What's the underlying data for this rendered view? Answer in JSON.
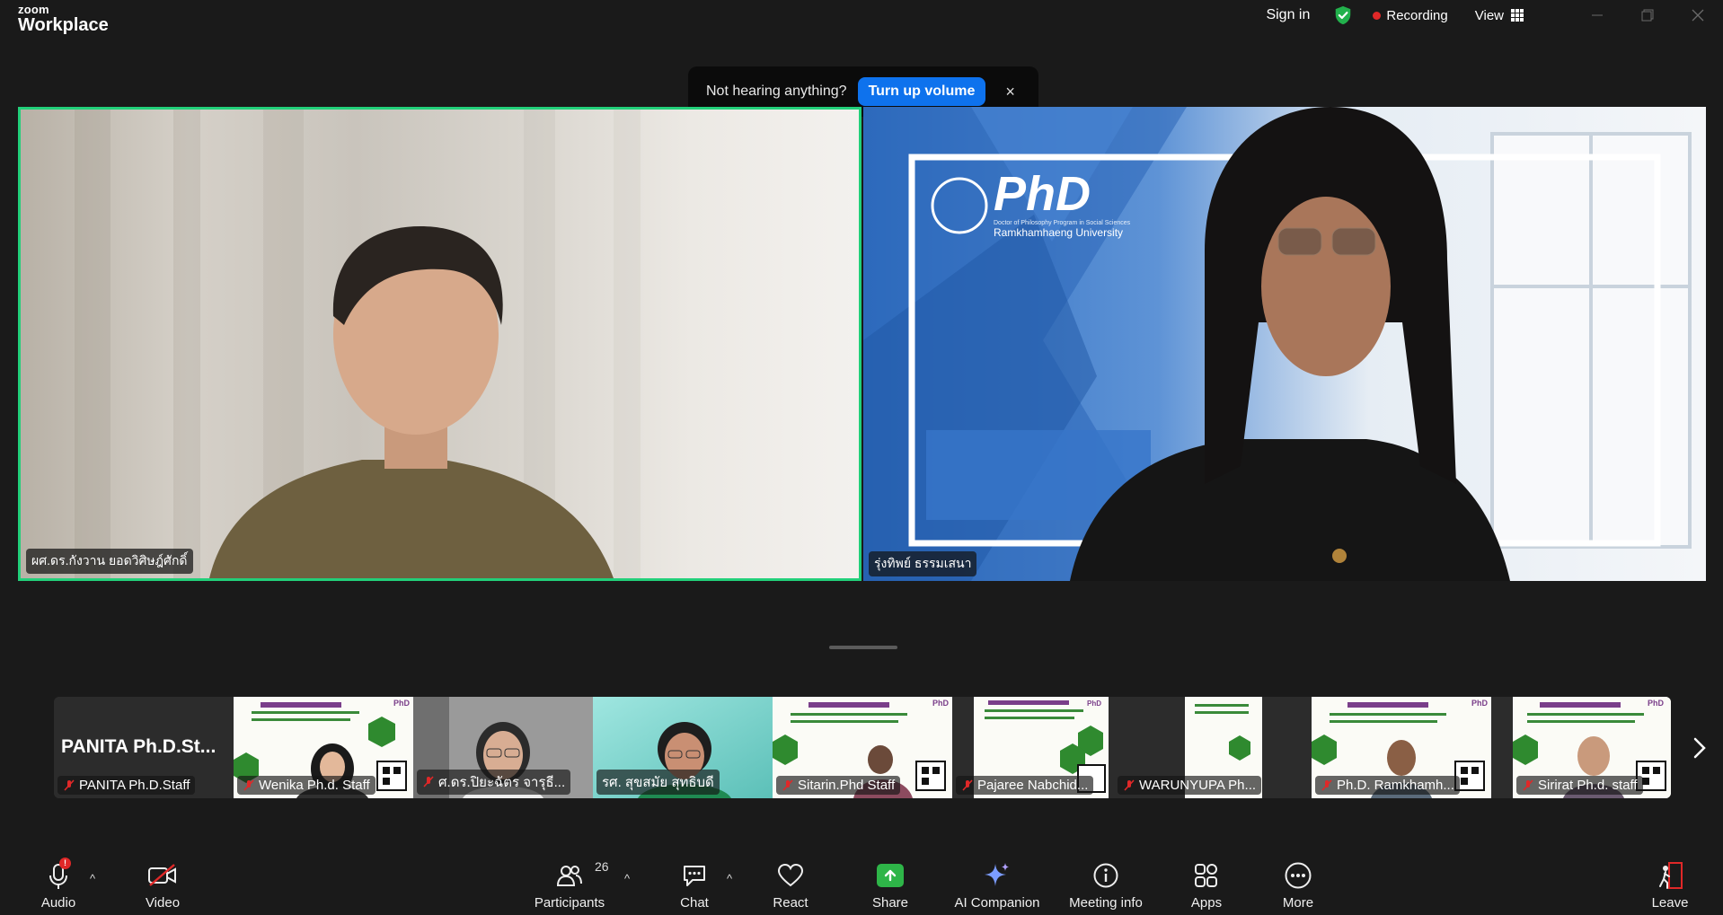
{
  "app": {
    "logo_line1": "zoom",
    "logo_line2": "Workplace"
  },
  "titlebar": {
    "sign_in": "Sign in",
    "recording": "Recording",
    "view": "View"
  },
  "toast": {
    "message": "Not hearing anything?",
    "button": "Turn up volume",
    "close": "×"
  },
  "main_videos": [
    {
      "name": "ผศ.ดร.กังวาน ยอดวิศิษฎ์ศักดิ์",
      "active_speaker": true
    },
    {
      "name": "รุ่งทิพย์ ธรรมเสนา",
      "active_speaker": false
    }
  ],
  "background_overlay": {
    "brand": "PhD",
    "line1": "Doctor of Philosophy Program in Social Sciences",
    "line2": "Ramkhamhaeng University"
  },
  "thumbnails": [
    {
      "name": "PANITA Ph.D.Staff",
      "display": "PANITA  Ph.D.St...",
      "muted": true,
      "video": false
    },
    {
      "name": "Wenika Ph.d. Staff",
      "muted": true,
      "video": true
    },
    {
      "name": "ศ.ดร.ปิยะฉัตร จารุธี...",
      "muted": true,
      "video": true
    },
    {
      "name": "รศ. สุขสมัย สุทธิบดี",
      "muted": false,
      "video": true
    },
    {
      "name": "Sitarin.Phd Staff",
      "muted": true,
      "video": true
    },
    {
      "name": "Pajaree Nabchid...",
      "muted": true,
      "video": true
    },
    {
      "name": "WARUNYUPA Ph...",
      "muted": true,
      "video": true
    },
    {
      "name": "Ph.D. Ramkhamh...",
      "muted": true,
      "video": true
    },
    {
      "name": "Sirirat Ph.d. staff",
      "muted": true,
      "video": true
    }
  ],
  "toolbar": {
    "audio": "Audio",
    "video": "Video",
    "participants": "Participants",
    "participant_count": "26",
    "chat": "Chat",
    "react": "React",
    "share": "Share",
    "ai_companion": "AI Companion",
    "meeting_info": "Meeting info",
    "apps": "Apps",
    "more": "More",
    "leave": "Leave",
    "audio_badge": "!"
  },
  "colors": {
    "active_speaker_border": "#22d07a",
    "primary_button": "#0e72ed",
    "share_green": "#2eb548",
    "recording_red": "#e02828",
    "leave_red": "#e02828"
  }
}
